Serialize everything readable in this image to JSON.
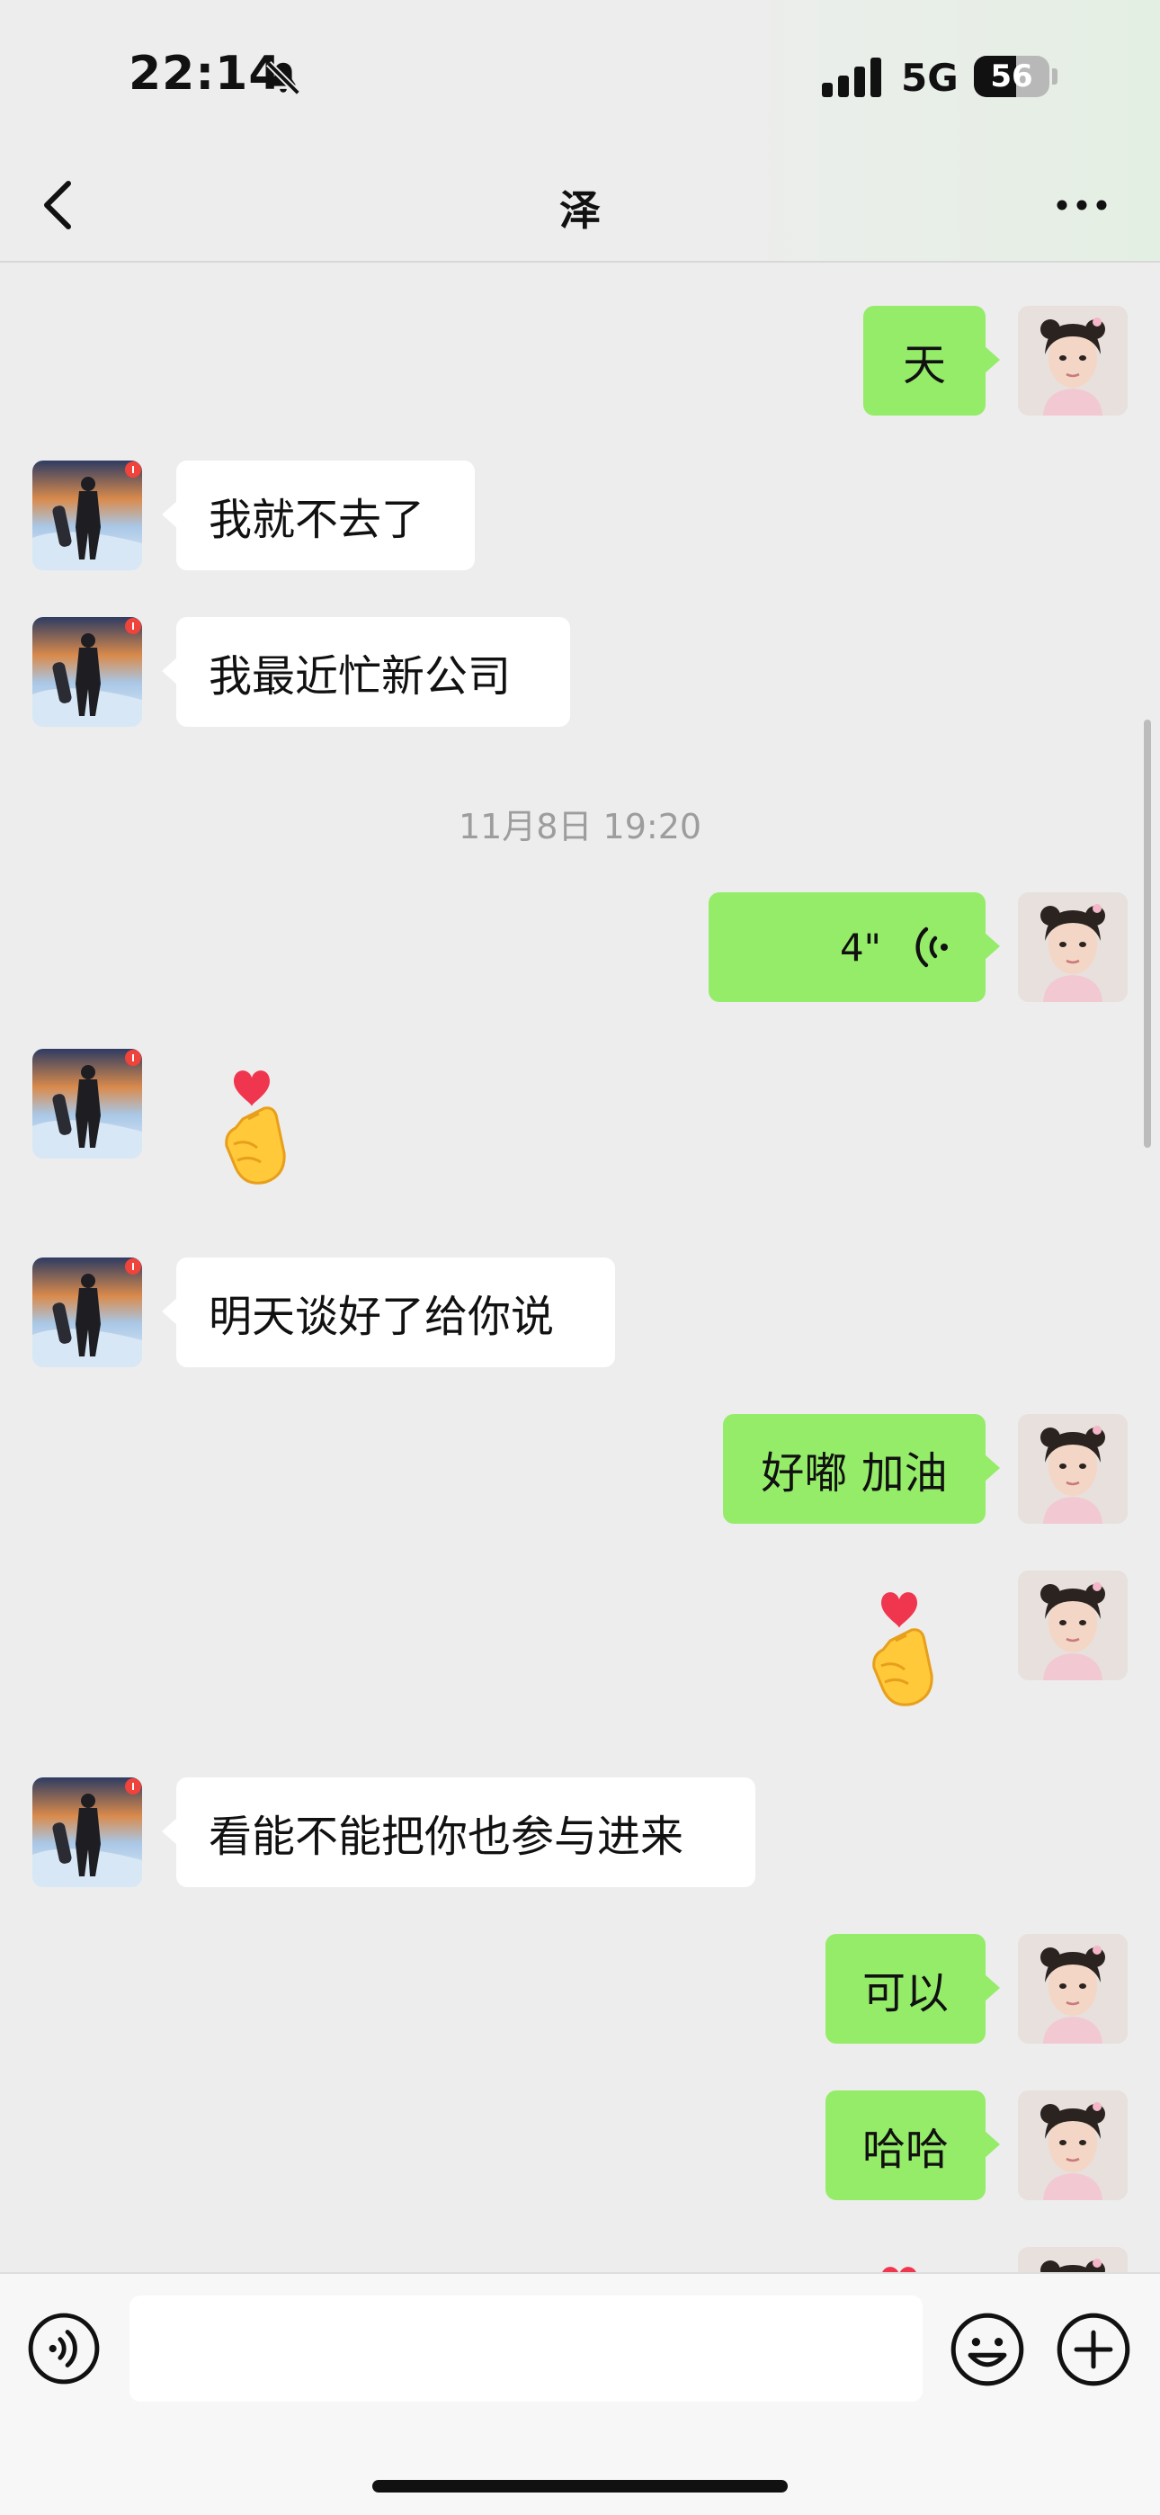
{
  "status_bar": {
    "time": "22:14",
    "network": "5G",
    "battery": "56",
    "battery_level": 0.56
  },
  "header": {
    "title": "泽"
  },
  "messages": [
    {
      "dir": "out",
      "type": "text",
      "text": "天"
    },
    {
      "dir": "in",
      "type": "text",
      "text": "我就不去了"
    },
    {
      "dir": "in",
      "type": "text",
      "text": "我最近忙新公司"
    },
    {
      "type": "timestamp",
      "text": "11月8日 19:20"
    },
    {
      "dir": "out",
      "type": "voice",
      "duration": "4\""
    },
    {
      "dir": "in",
      "type": "sticker",
      "sticker": "finger-heart"
    },
    {
      "dir": "in",
      "type": "text",
      "text": "明天谈好了给你说"
    },
    {
      "dir": "out",
      "type": "text",
      "text": "好嘟 加油"
    },
    {
      "dir": "out",
      "type": "sticker",
      "sticker": "finger-heart"
    },
    {
      "dir": "in",
      "type": "text",
      "text": "看能不能把你也参与进来"
    },
    {
      "dir": "out",
      "type": "text",
      "text": "可以"
    },
    {
      "dir": "out",
      "type": "text",
      "text": "哈哈"
    },
    {
      "dir": "out",
      "type": "sticker",
      "sticker": "finger-heart"
    }
  ],
  "input": {
    "placeholder": ""
  },
  "colors": {
    "outgoing_bubble": "#95ec69",
    "incoming_bubble": "#ffffff",
    "background": "#ededed",
    "badge": "#f0433c"
  }
}
